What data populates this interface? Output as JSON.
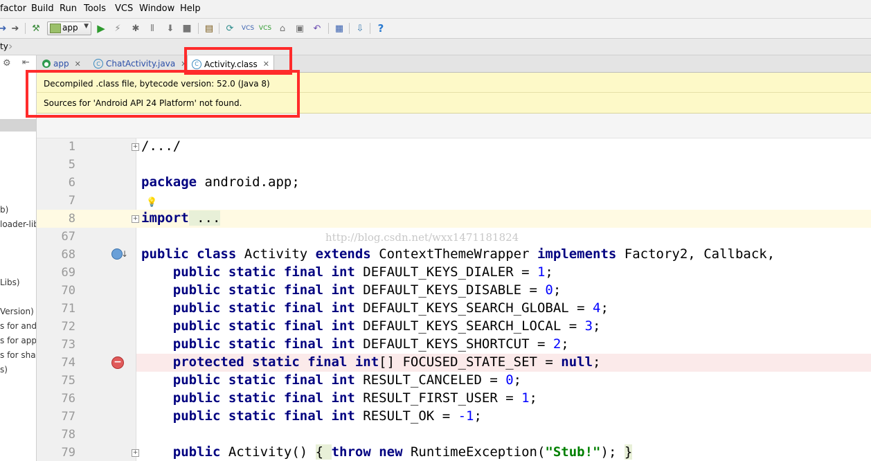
{
  "menu": [
    "factor",
    "Build",
    "Run",
    "Tools",
    "VCS",
    "Window",
    "Help"
  ],
  "toolbar": {
    "run_config": "app"
  },
  "nav": {
    "crumb": "ty"
  },
  "left_panel": [
    "b)",
    "loader-lib",
    "Libs)",
    "Version)",
    "s for andr",
    "s for app",
    "s for shar",
    "s)"
  ],
  "tabs": [
    {
      "label": "app",
      "icon": "android-module-icon"
    },
    {
      "label": "ChatActivity.java",
      "icon": "java-class-icon"
    },
    {
      "label": "Activity.class",
      "icon": "compiled-class-icon",
      "active": true
    }
  ],
  "banner": {
    "line1": "Decompiled .class file, bytecode version: 52.0 (Java 8)",
    "line2": "Sources for 'Android API 24 Platform' not found."
  },
  "watermark": "http://blog.csdn.net/wxx1471181824",
  "code": {
    "line_numbers": [
      "1",
      "5",
      "6",
      "7",
      "8",
      "67",
      "68",
      "69",
      "70",
      "71",
      "72",
      "73",
      "74",
      "75",
      "76",
      "77",
      "78",
      "79"
    ],
    "l1": "/.../",
    "l6_kw": "package",
    "l6_rest": " android.app;",
    "l8_kw": "import",
    "l8_rest": " ...",
    "l68_kw1": "public class",
    "l68_a": " Activity ",
    "l68_kw2": "extends",
    "l68_b": " ContextThemeWrapper ",
    "l68_kw3": "implements",
    "l68_c": " Factory2, Callback,",
    "mod_public": "    public static final int",
    "mod_protected": "    protected static final int",
    "l69": " DEFAULT_KEYS_DIALER = ",
    "v69": "1",
    "l70": " DEFAULT_KEYS_DISABLE = ",
    "v70": "0",
    "l71": " DEFAULT_KEYS_SEARCH_GLOBAL = ",
    "v71": "4",
    "l72": " DEFAULT_KEYS_SEARCH_LOCAL = ",
    "v72": "3",
    "l73": " DEFAULT_KEYS_SHORTCUT = ",
    "v73": "2",
    "l74": "[] FOCUSED_STATE_SET = ",
    "v74": "null",
    "l75": " RESULT_CANCELED = ",
    "v75": "0",
    "l76": " RESULT_FIRST_USER = ",
    "v76": "1",
    "l77": " RESULT_OK = ",
    "v77": "-1",
    "l79_kw": "    public",
    "l79_a": " Activity() ",
    "l79_b": "{ ",
    "l79_kw2": "throw new",
    "l79_c": " RuntimeException(",
    "l79_str": "\"Stub!\"",
    "l79_d": "); ",
    "l79_e": "}",
    "semi": ";"
  }
}
